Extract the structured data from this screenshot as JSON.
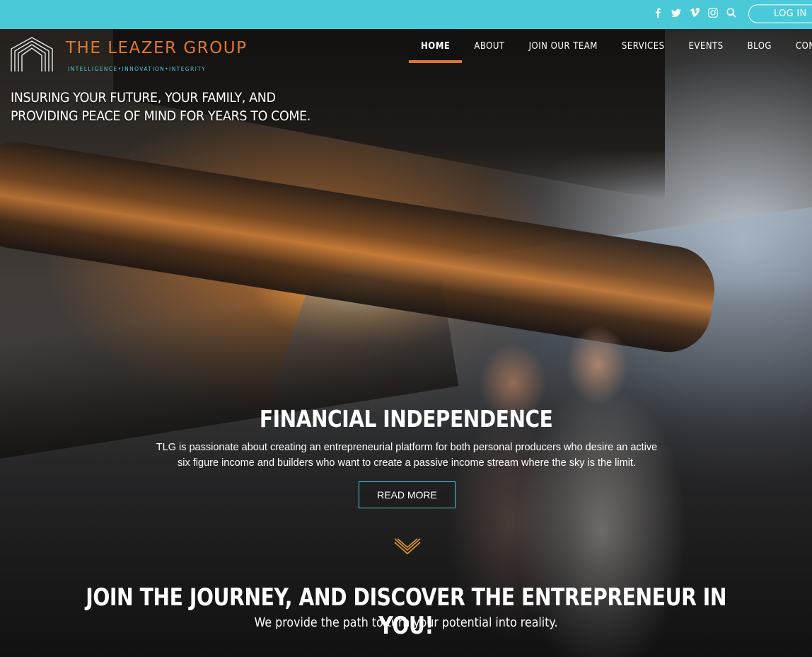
{
  "topbar": {
    "social_icons": [
      "facebook-icon",
      "twitter-icon",
      "vimeo-icon",
      "instagram-icon",
      "search-icon"
    ],
    "login_label": "LOG IN"
  },
  "brand": {
    "name": "THE LEAZER GROUP",
    "tagline": "INTELLIGENCE•INNOVATION•INTEGRITY"
  },
  "nav": {
    "items": [
      {
        "label": "HOME",
        "active": true
      },
      {
        "label": "ABOUT",
        "active": false
      },
      {
        "label": "JOIN OUR TEAM",
        "active": false
      },
      {
        "label": "SERVICES",
        "active": false
      },
      {
        "label": "EVENTS",
        "active": false
      },
      {
        "label": "BLOG",
        "active": false
      },
      {
        "label": "CONTACT",
        "active": false
      }
    ]
  },
  "hero": {
    "tagline_line1": "INSURING YOUR FUTURE, YOUR FAMILY, AND",
    "tagline_line2": "PROVIDING PEACE OF MIND FOR YEARS TO COME.",
    "title": "FINANCIAL INDEPENDENCE",
    "description_line1": "TLG is passionate about creating an entrepreneurial platform for both personal producers who desire an active",
    "description_line2": "six figure income and builders who want to create a passive income stream where the sky is the limit.",
    "cta_label": "READ MORE"
  },
  "journey": {
    "title": "JOIN THE JOURNEY, AND DISCOVER THE ENTREPRENEUR IN YOU!",
    "subtitle": "We provide the path to turn your potential into reality."
  },
  "colors": {
    "accent_teal": "#4ac9d9",
    "accent_orange": "#e0782c"
  }
}
